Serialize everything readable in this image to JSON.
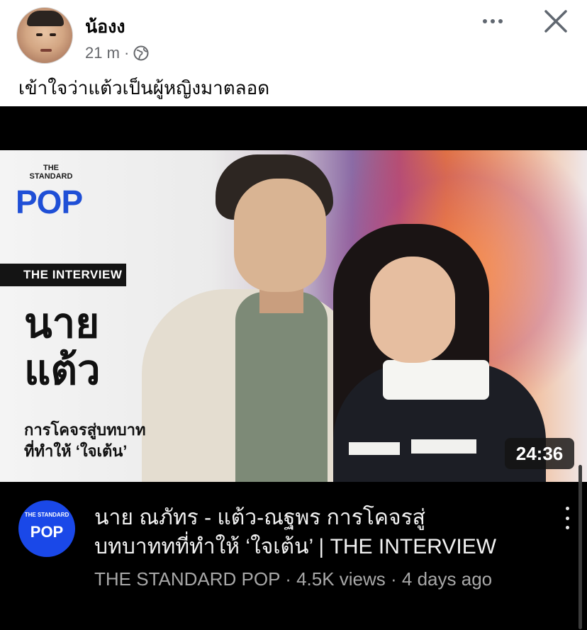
{
  "post": {
    "author": "น้องง",
    "time": "21 m ·",
    "caption": "เข้าใจว่าแต้วเป็นผู้หญิงมาตลอด",
    "icons": {
      "more": "more-icon",
      "close": "close-icon",
      "audience": "globe-icon"
    }
  },
  "thumbnail": {
    "brand_small": "THE STANDARD",
    "brand_pop": "POP",
    "label": "THE INTERVIEW",
    "title_line1": "นาย",
    "title_line2": "แต้ว",
    "subtitle_line1": "การโคจรสู่บทบาท",
    "subtitle_line2": "ที่ทำให้ ‘ใจเต้น’",
    "duration": "24:36"
  },
  "video": {
    "channel_avatar_small": "THE STANDARD",
    "channel_avatar_pop": "POP",
    "title_line1": "นาย ณภัทร - แต้ว-ณฐพร การโคจรสู่",
    "title_line2": "บทบาททที่ทำให้ ‘ใจเต้น’ | THE INTERVIEW",
    "meta": "THE STANDARD POP · 4.5K views · 4 days ago"
  },
  "colors": {
    "brand_blue": "#1f4fd6",
    "video_bg": "#000000",
    "meta_gray": "#a8a8a8"
  }
}
